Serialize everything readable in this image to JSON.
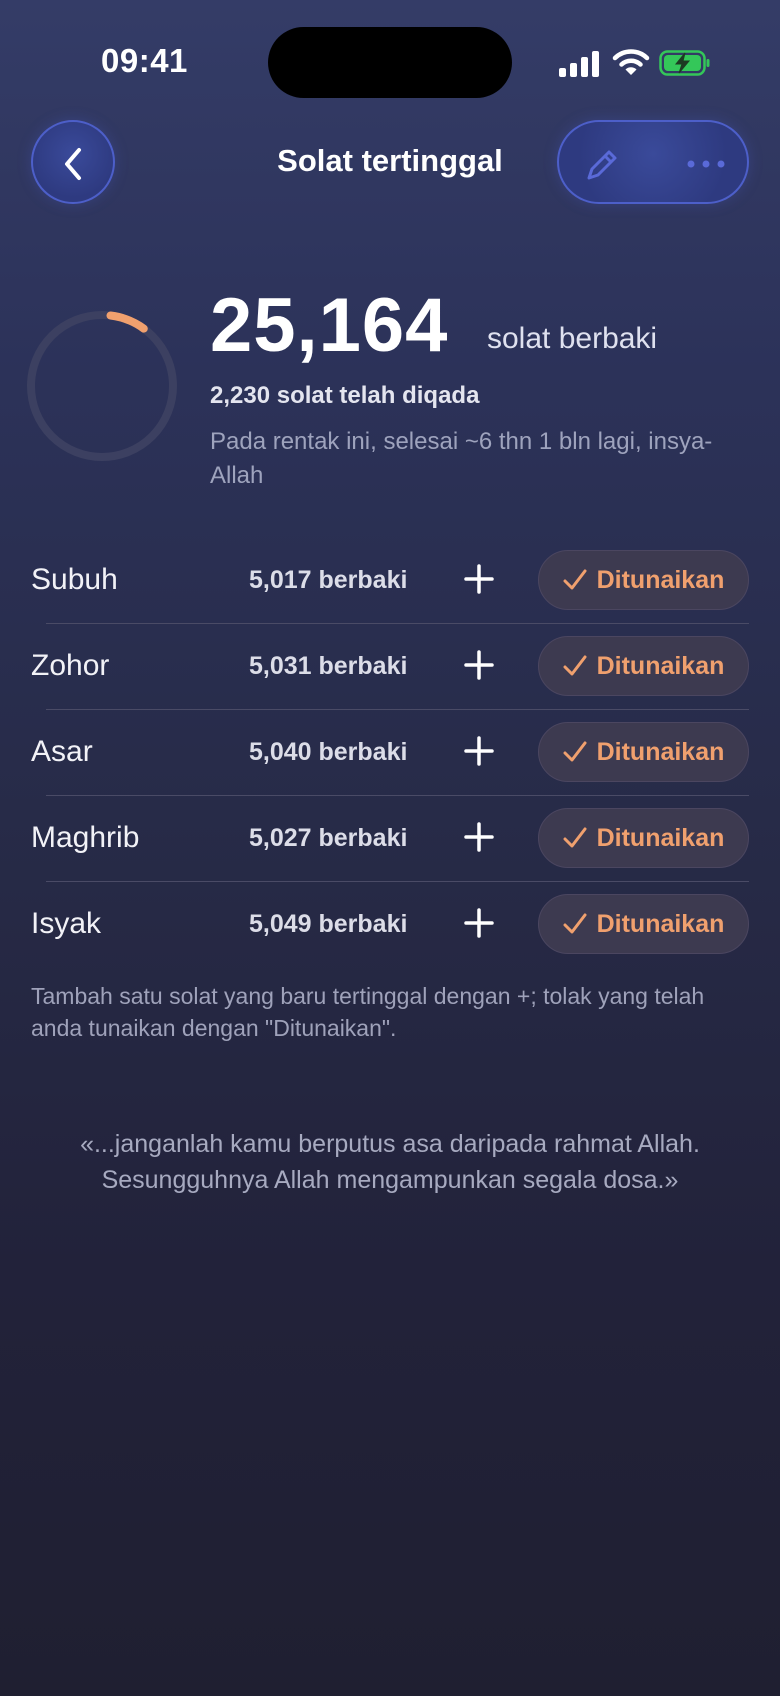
{
  "status_bar": {
    "time": "09:41",
    "battery_color": "#34c759"
  },
  "nav": {
    "back_icon": "chevron-left-icon",
    "title": "Solat tertinggal",
    "edit_icon": "pencil-icon",
    "more_icon": "ellipsis-icon"
  },
  "summary": {
    "remaining": "25,164",
    "remaining_unit": "solat berbaki",
    "made_up": "2,230 solat telah diqada",
    "eta": "Pada rentak ini, selesai ~6 thn 1 bln lagi, insya-Allah",
    "progress_fraction": 0.081
  },
  "prayers": [
    {
      "name": "Subuh",
      "remaining": "5,017 berbaki",
      "action": "Ditunaikan"
    },
    {
      "name": "Zohor",
      "remaining": "5,031 berbaki",
      "action": "Ditunaikan"
    },
    {
      "name": "Asar",
      "remaining": "5,040 berbaki",
      "action": "Ditunaikan"
    },
    {
      "name": "Maghrib",
      "remaining": "5,027 berbaki",
      "action": "Ditunaikan"
    },
    {
      "name": "Isyak",
      "remaining": "5,049 berbaki",
      "action": "Ditunaikan"
    }
  ],
  "hint": "Tambah satu solat yang baru tertinggal dengan +; tolak yang telah anda tunaikan dengan \"Ditunaikan\".",
  "quote": "«...janganlah kamu berputus asa daripada rahmat Allah. Sesungguhnya Allah mengampunkan segala dosa.»",
  "colors": {
    "accent": "#f0a06e",
    "nav_button_border": "#4d5fc9",
    "ring_track": "#3c4061"
  }
}
